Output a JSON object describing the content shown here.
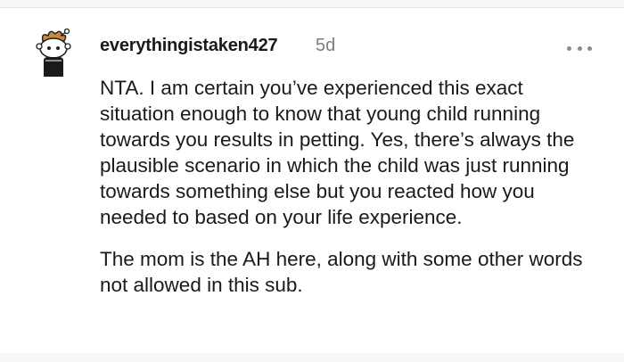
{
  "comment": {
    "username": "everythingistaken427",
    "age": "5d",
    "paragraphs": [
      "NTA. I am certain you’ve experienced this exact situation enough to know that young child running towards you results in petting. Yes, there’s always the plausible scenario in which the child was just running towards something else but you reacted how you needed to based on your life experience.",
      "The mom is the AH here, along with some other words not allowed in this sub."
    ],
    "more_icon": "more-horizontal-icon",
    "avatar_icon": "snoo-avatar-icon"
  }
}
